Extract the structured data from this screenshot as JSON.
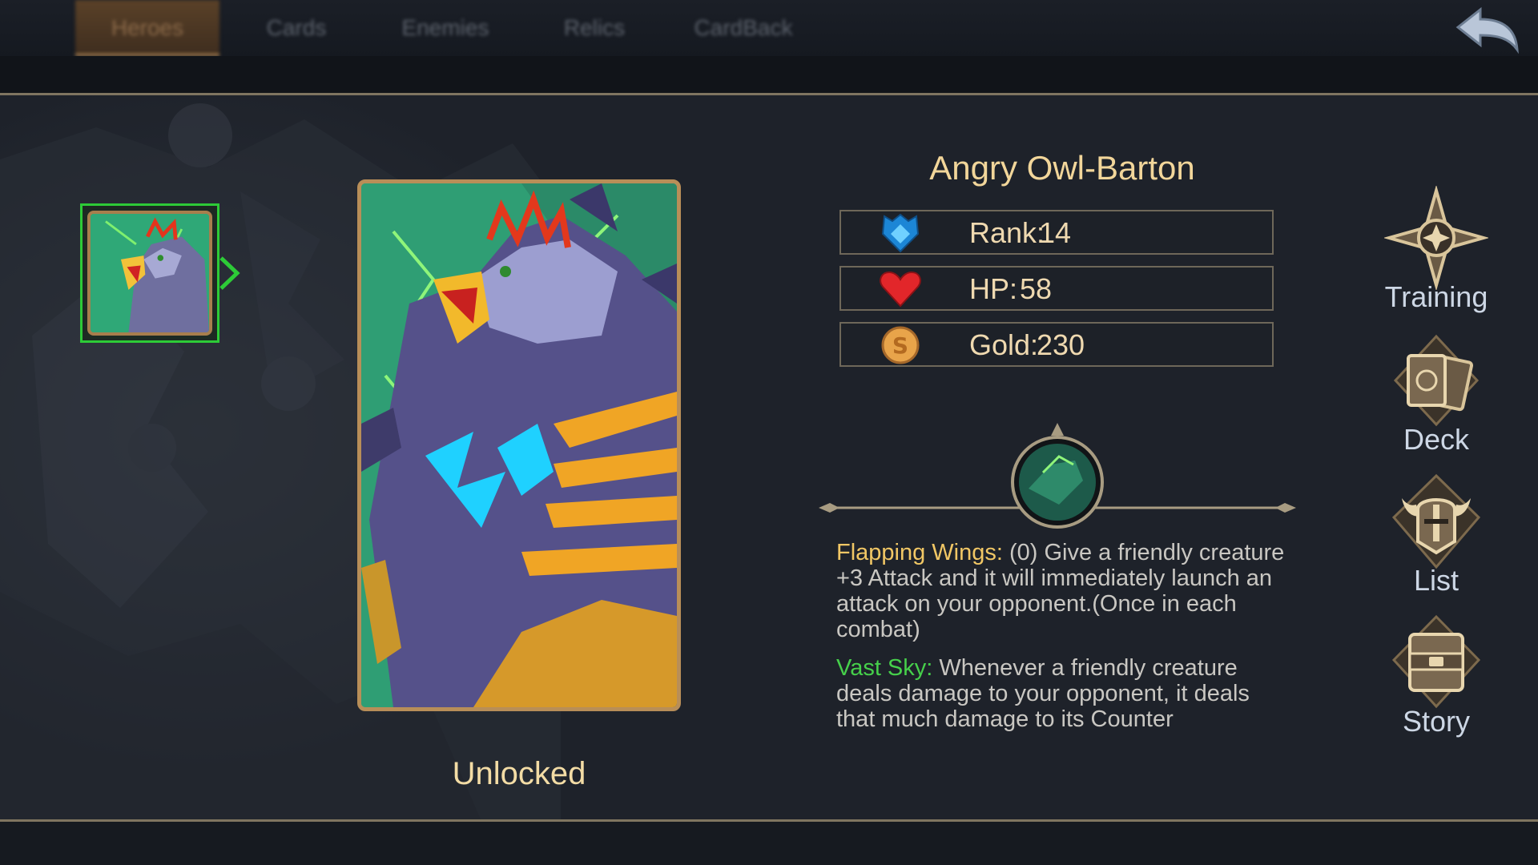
{
  "tabs": [
    {
      "label": "Heroes",
      "active": true
    },
    {
      "label": "Cards",
      "active": false
    },
    {
      "label": "Enemies",
      "active": false
    },
    {
      "label": "Relics",
      "active": false
    },
    {
      "label": "CardBack",
      "active": false
    }
  ],
  "back_icon": "back-arrow-icon",
  "hero": {
    "name": "Angry Owl-Barton",
    "status": "Unlocked",
    "stats": [
      {
        "icon": "rank-shield-icon",
        "label": "Rank:",
        "value": "14"
      },
      {
        "icon": "heart-icon",
        "label": "HP:",
        "value": "58"
      },
      {
        "icon": "gold-coin-icon",
        "label": "Gold:",
        "value": "230"
      }
    ],
    "skills": [
      {
        "name": "Flapping Wings:",
        "text": "(0) Give a friendly creature +3 Attack and it will immediately launch an attack on your opponent.(Once in each combat)",
        "color": "#f1c765"
      },
      {
        "name": "Vast Sky:",
        "text": "Whenever a friendly creature deals damage to your opponent, it deals  that much damage to its Counter",
        "color": "#46d04b"
      }
    ]
  },
  "menu": [
    {
      "label": "Training",
      "icon": "compass-star-icon"
    },
    {
      "label": "Deck",
      "icon": "card-deck-icon"
    },
    {
      "label": "List",
      "icon": "horned-helmet-icon"
    },
    {
      "label": "Story",
      "icon": "book-icon"
    }
  ],
  "colors": {
    "accent_gold": "#f2d69a",
    "selection_green": "#2dcb37",
    "frame_bronze": "#b88e58"
  }
}
